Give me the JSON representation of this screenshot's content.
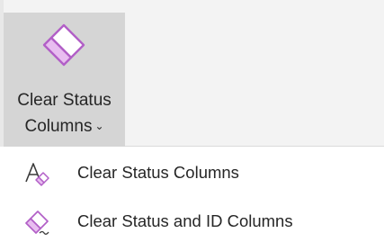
{
  "ribbon": {
    "button": {
      "label_line1": "Clear Status",
      "label_line2": "Columns",
      "chevron": "⌄",
      "icon": "eraser-icon"
    }
  },
  "menu": {
    "items": [
      {
        "label": "Clear Status Columns",
        "icon": "clear-formatting-icon"
      },
      {
        "label": "Clear Status and ID Columns",
        "icon": "eraser-icon"
      }
    ]
  },
  "colors": {
    "accent_purple": "#b25fc7",
    "accent_purple_light": "#e8bdf0",
    "text": "#262626",
    "ribbon_bg": "#f3f3f3",
    "pressed_bg": "#d5d5d5"
  }
}
